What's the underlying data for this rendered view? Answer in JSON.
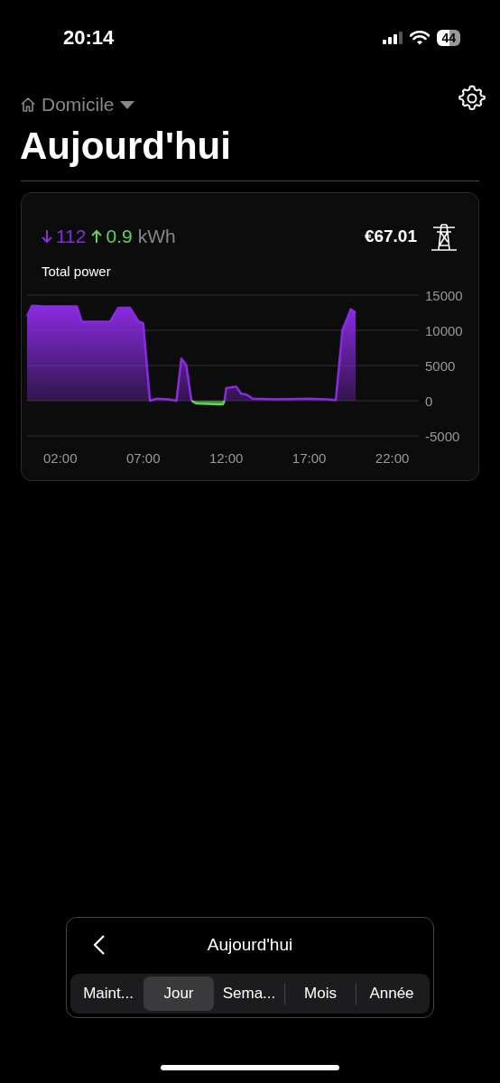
{
  "status_bar": {
    "time": "20:14",
    "battery": "44"
  },
  "header": {
    "location": "Domicile",
    "title": "Aujourd'hui"
  },
  "card": {
    "import_value": "112",
    "export_value": "0.9",
    "unit": "kWh",
    "cost": "€67.01",
    "label": "Total power",
    "chart_data": {
      "type": "area",
      "x": [
        0,
        0.3,
        1,
        2,
        3,
        3.3,
        4,
        5,
        5.5,
        6.2,
        6.7,
        7,
        7.4,
        7.8,
        8.5,
        9,
        9.3,
        9.6,
        9.9,
        10.2,
        11.5,
        11.8,
        11.9,
        12,
        12.6,
        12.9,
        13.2,
        13.6,
        15,
        17,
        18,
        18.6,
        19,
        19.5,
        19.8
      ],
      "series": [
        {
          "color": "#8a2be2",
          "values": [
            12000,
            13500,
            13400,
            13400,
            13400,
            11200,
            11200,
            11200,
            13200,
            13200,
            11300,
            11000,
            0,
            300,
            200,
            0,
            6000,
            5000,
            0,
            null,
            null,
            null,
            0,
            1800,
            2000,
            1000,
            900,
            300,
            200,
            300,
            200,
            100,
            10000,
            13000,
            12500
          ]
        },
        {
          "color": "#5fd35a",
          "values": [
            null,
            null,
            null,
            null,
            null,
            null,
            null,
            null,
            null,
            null,
            null,
            null,
            null,
            null,
            null,
            null,
            null,
            null,
            0,
            -400,
            -500,
            -500,
            0,
            null,
            null,
            null,
            null,
            null,
            null,
            null,
            null,
            null,
            null,
            null,
            null
          ]
        }
      ],
      "xlim": [
        0,
        23.6
      ],
      "ylim": [
        -5000,
        15000
      ],
      "grid": true,
      "xticks": [
        {
          "value": 2,
          "label": "02:00"
        },
        {
          "value": 7,
          "label": "07:00"
        },
        {
          "value": 12,
          "label": "12:00"
        },
        {
          "value": 17,
          "label": "17:00"
        },
        {
          "value": 22,
          "label": "22:00"
        }
      ],
      "yticks": [
        15000,
        10000,
        5000,
        0,
        -5000
      ]
    }
  },
  "period_picker": {
    "title": "Aujourd'hui",
    "tabs": [
      {
        "label": "Maint...",
        "selected": false
      },
      {
        "label": "Jour",
        "selected": true
      },
      {
        "label": "Sema...",
        "selected": false
      },
      {
        "label": "Mois",
        "selected": false
      },
      {
        "label": "Année",
        "selected": false
      }
    ]
  }
}
